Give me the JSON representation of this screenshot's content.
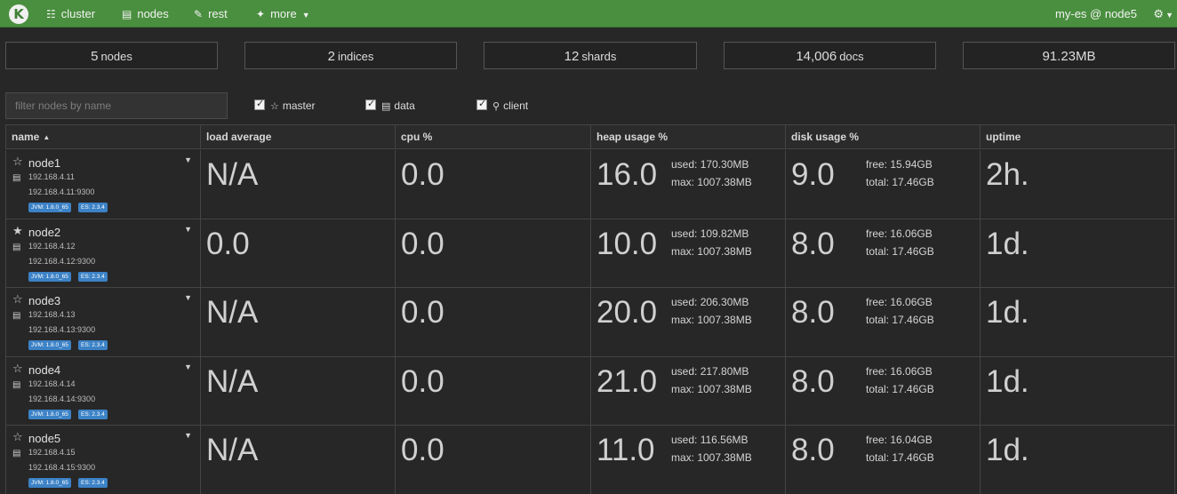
{
  "navbar": {
    "logo": "K",
    "items": [
      {
        "label": "cluster",
        "icon": "sitemap-icon"
      },
      {
        "label": "nodes",
        "icon": "server-icon"
      },
      {
        "label": "rest",
        "icon": "edit-icon"
      },
      {
        "label": "more",
        "icon": "magic-wand-icon"
      }
    ],
    "cluster_name": "my-es @ node5"
  },
  "stats": [
    {
      "value": "5",
      "label": "nodes"
    },
    {
      "value": "2",
      "label": "indices"
    },
    {
      "value": "12",
      "label": "shards"
    },
    {
      "value": "14,006",
      "label": "docs"
    },
    {
      "value": "91.23MB",
      "label": ""
    }
  ],
  "filter": {
    "placeholder": "filter nodes by name",
    "checkboxes": [
      {
        "label": "master",
        "checked": true,
        "icon": "star-icon"
      },
      {
        "label": "data",
        "checked": true,
        "icon": "hdd-icon"
      },
      {
        "label": "client",
        "checked": true,
        "icon": "search-icon"
      }
    ]
  },
  "table": {
    "columns": [
      "name",
      "load average",
      "cpu %",
      "heap usage %",
      "disk usage %",
      "uptime"
    ],
    "rows": [
      {
        "name": "node1",
        "master": false,
        "ip": "192.168.4.11",
        "addr": "192.168.4.11:9300",
        "jvm": "JVM: 1.8.0_65",
        "es": "ES: 2.3.4",
        "load": "N/A",
        "cpu": "0.0",
        "heap": "16.0",
        "heap_used": "used: 170.30MB",
        "heap_max": "max: 1007.38MB",
        "disk": "9.0",
        "disk_free": "free: 15.94GB",
        "disk_total": "total: 17.46GB",
        "uptime": "2h."
      },
      {
        "name": "node2",
        "master": true,
        "ip": "192.168.4.12",
        "addr": "192.168.4.12:9300",
        "jvm": "JVM: 1.8.0_65",
        "es": "ES: 2.3.4",
        "load": "0.0",
        "cpu": "0.0",
        "heap": "10.0",
        "heap_used": "used: 109.82MB",
        "heap_max": "max: 1007.38MB",
        "disk": "8.0",
        "disk_free": "free: 16.06GB",
        "disk_total": "total: 17.46GB",
        "uptime": "1d."
      },
      {
        "name": "node3",
        "master": false,
        "ip": "192.168.4.13",
        "addr": "192.168.4.13:9300",
        "jvm": "JVM: 1.8.0_65",
        "es": "ES: 2.3.4",
        "load": "N/A",
        "cpu": "0.0",
        "heap": "20.0",
        "heap_used": "used: 206.30MB",
        "heap_max": "max: 1007.38MB",
        "disk": "8.0",
        "disk_free": "free: 16.06GB",
        "disk_total": "total: 17.46GB",
        "uptime": "1d."
      },
      {
        "name": "node4",
        "master": false,
        "ip": "192.168.4.14",
        "addr": "192.168.4.14:9300",
        "jvm": "JVM: 1.8.0_65",
        "es": "ES: 2.3.4",
        "load": "N/A",
        "cpu": "0.0",
        "heap": "21.0",
        "heap_used": "used: 217.80MB",
        "heap_max": "max: 1007.38MB",
        "disk": "8.0",
        "disk_free": "free: 16.06GB",
        "disk_total": "total: 17.46GB",
        "uptime": "1d."
      },
      {
        "name": "node5",
        "master": false,
        "ip": "192.168.4.15",
        "addr": "192.168.4.15:9300",
        "jvm": "JVM: 1.8.0_65",
        "es": "ES: 2.3.4",
        "load": "N/A",
        "cpu": "0.0",
        "heap": "11.0",
        "heap_used": "used: 116.56MB",
        "heap_max": "max: 1007.38MB",
        "disk": "8.0",
        "disk_free": "free: 16.04GB",
        "disk_total": "total: 17.46GB",
        "uptime": "1d."
      }
    ]
  },
  "colors": {
    "navbar": "#4a8f3f",
    "badge": "#3c82c6",
    "background": "#272727"
  }
}
